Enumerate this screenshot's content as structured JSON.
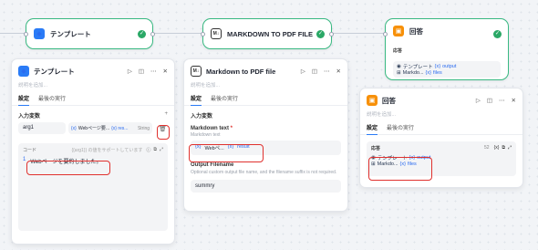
{
  "nodes": {
    "template": {
      "title": "テンプレート",
      "icon": "template-icon"
    },
    "markdown": {
      "title": "MARKDOWN TO PDF FILE",
      "icon": "md-icon"
    },
    "answer": {
      "title": "回答",
      "icon": "answer-icon",
      "sub_label": "応答",
      "line1_a": "テンプレート",
      "line1_b": "output",
      "line2_a": "Markdo...",
      "line2_b": "files"
    }
  },
  "template_panel": {
    "title": "テンプレート",
    "desc": "説明を追加...",
    "tab1": "設定",
    "tab2": "最後の実行",
    "input_vars": "入力変数",
    "var_name": "arg1",
    "var_value": "Webページ要...",
    "var_source": "{x} res...",
    "var_type": "String",
    "code_label": "コード",
    "code_hint": "{{arg1}} の値をサポートしています",
    "line_no": "1",
    "code_text": "Webページを要約しました。"
  },
  "md_panel": {
    "title": "Markdown to PDF file",
    "desc": "説明を追加...",
    "tab1": "設定",
    "tab2": "最後の実行",
    "input_vars": "入力変数",
    "md_text_label": "Markdown text",
    "md_text_sub": "Markdown text",
    "md_chip_a": "Webペ...",
    "md_chip_b": "result",
    "out_label": "Output Filename",
    "out_desc": "Optional custom output file name, and the filename suffix is not required.",
    "out_value": "summry"
  },
  "answer_panel": {
    "title": "回答",
    "desc": "説明を追加...",
    "tab1": "設定",
    "tab2": "最後の実行",
    "resp_label": "応答",
    "count": "52",
    "chip1_a": "テンプレート",
    "chip1_b": "output",
    "chip2_a": "Markdo...",
    "chip2_b": "files"
  },
  "colors": {
    "accent": "#2a7bf6",
    "success": "#2aa866",
    "highlight": "#e0312e"
  }
}
